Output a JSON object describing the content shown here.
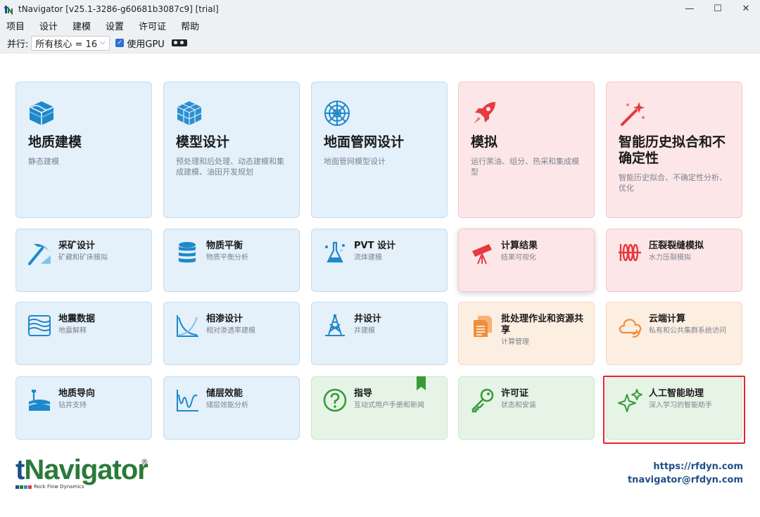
{
  "window": {
    "title": "tNavigator [v25.1-3286-g60681b3087c9] [trial]",
    "minimize": "—",
    "maximize": "☐",
    "close": "✕"
  },
  "menu": [
    "项目",
    "设计",
    "建模",
    "设置",
    "许可证",
    "帮助"
  ],
  "toolbar": {
    "parallel_label": "并行:",
    "cores_value": "所有核心 = 16",
    "use_gpu_label": "使用GPU",
    "use_gpu_checked": true
  },
  "tiles": {
    "geology": {
      "title": "地质建模",
      "desc": "静态建模",
      "icon": "cube-layers-icon"
    },
    "model_design": {
      "title": "模型设计",
      "desc": "预处理和后处理、动态建模和集成建模、油田开发规划",
      "icon": "grid-cube-icon"
    },
    "surface_network": {
      "title": "地面管网设计",
      "desc": "地面管网模型设计",
      "icon": "network-web-icon"
    },
    "simulation": {
      "title": "模拟",
      "desc": "运行黑油、组分、热采和集成模型",
      "icon": "rocket-icon"
    },
    "history_matching": {
      "title": "智能历史拟合和不确定性",
      "desc": "智能历史拟合、不确定性分析、优化",
      "icon": "magic-wand-icon"
    },
    "mining": {
      "title": "采矿设计",
      "desc": "矿藏和矿床模拟",
      "icon": "pickaxe-icon"
    },
    "material_balance": {
      "title": "物质平衡",
      "desc": "物质平衡分析",
      "icon": "database-icon"
    },
    "pvt": {
      "title": "PVT 设计",
      "desc": "流体建模",
      "icon": "flask-icon"
    },
    "results": {
      "title": "计算结果",
      "desc": "结果可视化",
      "icon": "telescope-icon"
    },
    "fracture": {
      "title": "压裂裂缝模拟",
      "desc": "水力压裂模拟",
      "icon": "fracture-icon"
    },
    "seismic": {
      "title": "地震数据",
      "desc": "地震解释",
      "icon": "seismic-waves-icon"
    },
    "relperm": {
      "title": "相渗设计",
      "desc": "相对渗透率建模",
      "icon": "curve-chart-icon"
    },
    "well_design": {
      "title": "井设计",
      "desc": "井建模",
      "icon": "drilling-rig-icon"
    },
    "batch": {
      "title": "批处理作业和资源共享",
      "desc": "计算管理",
      "icon": "documents-icon"
    },
    "cloud": {
      "title": "云端计算",
      "desc": "私有和公共集群系统访问",
      "icon": "cloud-icon"
    },
    "geosteering": {
      "title": "地质导向",
      "desc": "钻井支持",
      "icon": "geosteering-icon"
    },
    "reservoir_perf": {
      "title": "储层效能",
      "desc": "储层效能分析",
      "icon": "reservoir-curve-icon"
    },
    "guide": {
      "title": "指导",
      "desc": "互动式用户手册和新闻",
      "icon": "question-circle-icon"
    },
    "license": {
      "title": "许可证",
      "desc": "状态和安装",
      "icon": "key-icon"
    },
    "ai_assistant": {
      "title": "人工智能助理",
      "desc": "深入学习的智能助手",
      "icon": "sparkles-icon"
    }
  },
  "footer": {
    "logo_t": "t",
    "logo_rest": "Navigator",
    "logo_reg": "®",
    "logo_tagline": "Rock Flow Dynamics",
    "url": "https://rfdyn.com",
    "email": "tnavigator@rfdyn.com"
  },
  "colors": {
    "blue_tile": "#e4f0fa",
    "pink_tile": "#fde6e7",
    "peach_tile": "#fdeee2",
    "green_tile": "#e6f4e6",
    "highlight": "#e8232a",
    "link": "#1f4f86"
  }
}
